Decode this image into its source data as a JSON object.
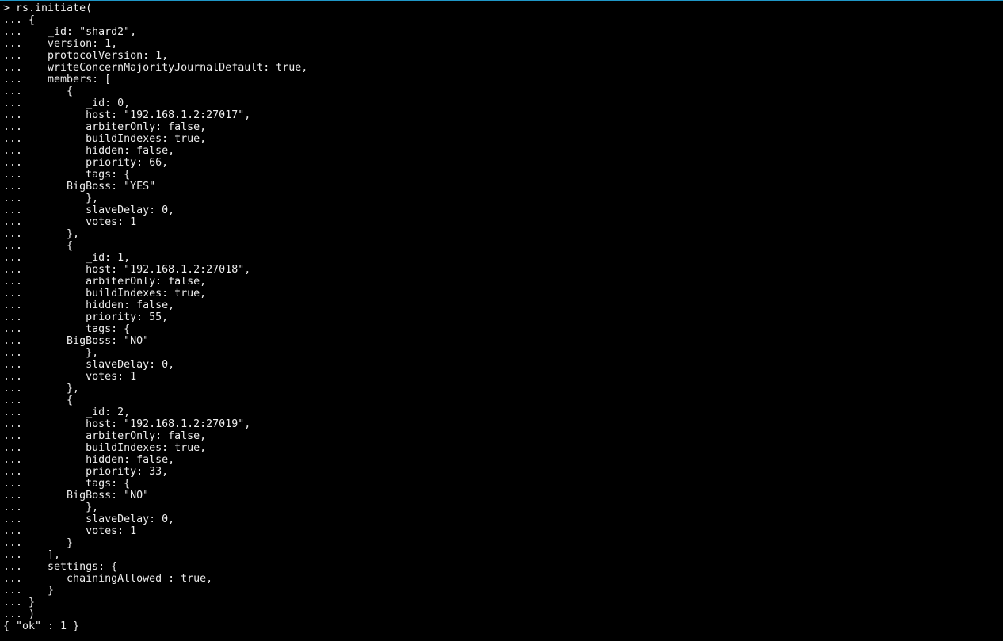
{
  "lines": [
    "> rs.initiate(",
    "... {",
    "...    _id: \"shard2\",",
    "...    version: 1,",
    "...    protocolVersion: 1,",
    "...    writeConcernMajorityJournalDefault: true,",
    "...    members: [",
    "...       {",
    "...          _id: 0,",
    "...          host: \"192.168.1.2:27017\",",
    "...          arbiterOnly: false,",
    "...          buildIndexes: true,",
    "...          hidden: false,",
    "...          priority: 66,",
    "...          tags: {",
    "...       BigBoss: \"YES\"",
    "...          },",
    "...          slaveDelay: 0,",
    "...          votes: 1",
    "...       },",
    "...       {",
    "...          _id: 1,",
    "...          host: \"192.168.1.2:27018\",",
    "...          arbiterOnly: false,",
    "...          buildIndexes: true,",
    "...          hidden: false,",
    "...          priority: 55,",
    "...          tags: {",
    "...       BigBoss: \"NO\"",
    "...          },",
    "...          slaveDelay: 0,",
    "...          votes: 1",
    "...       },",
    "...       {",
    "...          _id: 2,",
    "...          host: \"192.168.1.2:27019\",",
    "...          arbiterOnly: false,",
    "...          buildIndexes: true,",
    "...          hidden: false,",
    "...          priority: 33,",
    "...          tags: {",
    "...       BigBoss: \"NO\"",
    "...          },",
    "...          slaveDelay: 0,",
    "...          votes: 1",
    "...       }",
    "...    ],",
    "...    settings: {",
    "...       chainingAllowed : true,",
    "...    }",
    "... }",
    "... )",
    "{ \"ok\" : 1 }"
  ]
}
